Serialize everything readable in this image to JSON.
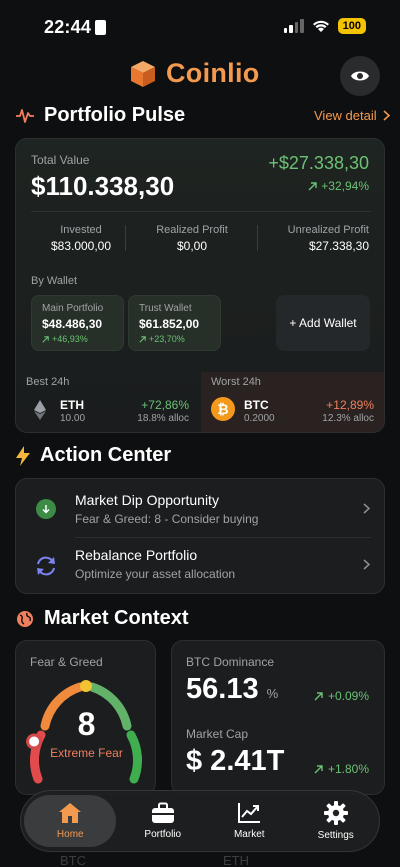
{
  "status_bar": {
    "time": "22:44",
    "battery": "100"
  },
  "header": {
    "app_name": "Coinlio"
  },
  "pulse": {
    "title": "Portfolio Pulse",
    "view_detail": "View detail",
    "total_value_label": "Total Value",
    "total_value": "$110.338,30",
    "total_profit": "+$27.338,30",
    "total_profit_pct": "+32,94%",
    "invested_label": "Invested",
    "invested": "$83.000,00",
    "realized_label": "Realized Profit",
    "realized": "$0,00",
    "unrealized_label": "Unrealized Profit",
    "unrealized": "$27.338,30",
    "by_wallet_label": "By Wallet",
    "wallets": [
      {
        "name": "Main Portfolio",
        "value": "$48.486,30",
        "change": "+46,93%"
      },
      {
        "name": "Trust Wallet",
        "value": "$61.852,00",
        "change": "+23,70%"
      }
    ],
    "add_wallet": "+ Add Wallet",
    "best_label": "Best 24h",
    "best": {
      "symbol": "ETH",
      "amount": "10.00",
      "change": "+72,86%",
      "alloc": "18.8% alloc"
    },
    "worst_label": "Worst 24h",
    "worst": {
      "symbol": "BTC",
      "amount": "0.2000",
      "change": "+12,89%",
      "alloc": "12.3% alloc"
    }
  },
  "actions": {
    "title": "Action Center",
    "items": [
      {
        "title": "Market Dip Opportunity",
        "subtitle": "Fear & Greed: 8 - Consider buying"
      },
      {
        "title": "Rebalance Portfolio",
        "subtitle": "Optimize your asset allocation"
      }
    ]
  },
  "market": {
    "title": "Market Context",
    "fear_greed_label": "Fear & Greed",
    "fear_greed_value": "8",
    "fear_greed_text": "Extreme Fear",
    "fear_greed_level": 0.08,
    "dominance_label": "BTC Dominance",
    "dominance_value": "56.13",
    "dominance_unit": "%",
    "dominance_change": "+0.09%",
    "market_cap_label": "Market Cap",
    "market_cap_value": "$ 2.41T",
    "market_cap_change": "+1.80%"
  },
  "behind_nav": {
    "left": "BTC",
    "right": "ETH"
  },
  "nav": {
    "items": [
      {
        "label": "Home"
      },
      {
        "label": "Portfolio"
      },
      {
        "label": "Market"
      },
      {
        "label": "Settings"
      }
    ]
  },
  "colors": {
    "accent": "#f39a4f",
    "positive": "#6cc174",
    "negative": "#f07f5e",
    "background": "#0e0f10"
  }
}
